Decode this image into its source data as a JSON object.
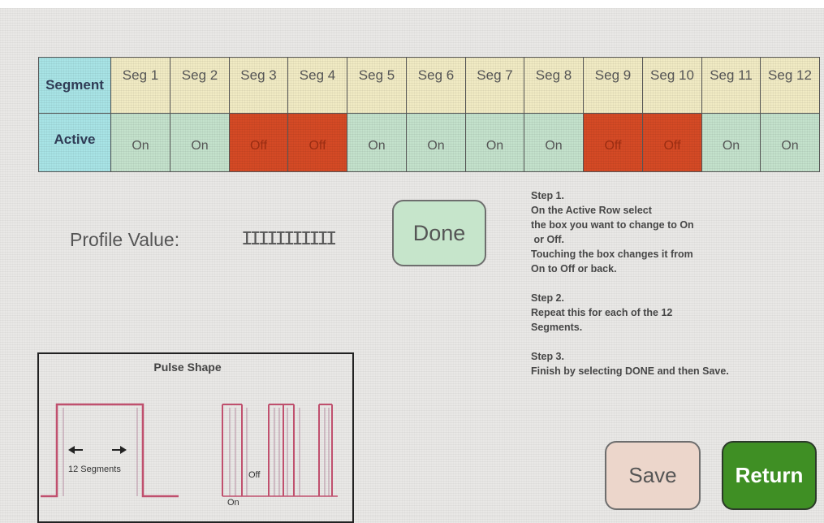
{
  "table": {
    "row_header_segment": "Segment",
    "row_header_active": "Active",
    "segments": [
      {
        "label": "Seg 1",
        "state": "On"
      },
      {
        "label": "Seg 2",
        "state": "On"
      },
      {
        "label": "Seg 3",
        "state": "Off"
      },
      {
        "label": "Seg 4",
        "state": "Off"
      },
      {
        "label": "Seg 5",
        "state": "On"
      },
      {
        "label": "Seg 6",
        "state": "On"
      },
      {
        "label": "Seg 7",
        "state": "On"
      },
      {
        "label": "Seg 8",
        "state": "On"
      },
      {
        "label": "Seg 9",
        "state": "Off"
      },
      {
        "label": "Seg 10",
        "state": "Off"
      },
      {
        "label": "Seg 11",
        "state": "On"
      },
      {
        "label": "Seg 12",
        "state": "On"
      }
    ]
  },
  "profile": {
    "label": "Profile Value:",
    "value": "IIIIIIIIIII"
  },
  "buttons": {
    "done": "Done",
    "save": "Save",
    "return": "Return"
  },
  "instructions": {
    "step1": [
      "Step 1.",
      "On the Active Row select",
      "the box you want to change to On",
      " or Off.",
      "Touching the box changes it from",
      "On to Off or back."
    ],
    "step2": [
      "Step 2.",
      "Repeat this for each of the 12",
      "Segments."
    ],
    "step3": [
      "Step 3.",
      "Finish by selecting DONE and then Save."
    ]
  },
  "pulse_shape": {
    "title": "Pulse Shape",
    "segments_label": "12 Segments",
    "off_label": "Off",
    "on_label": "On"
  },
  "colors": {
    "on": "#c4e2cc",
    "off": "#d54a25",
    "header": "#a8e4e6",
    "segment_header": "#f1ebc4",
    "return": "#3f8f24",
    "pulse_line": "#c0506e"
  }
}
